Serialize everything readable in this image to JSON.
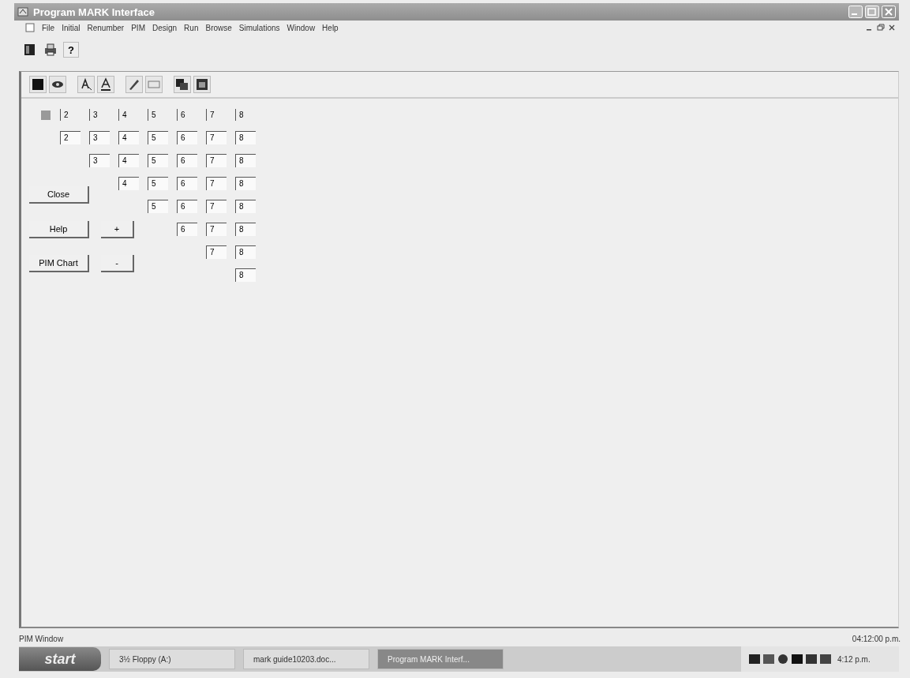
{
  "window": {
    "title": "Program MARK Interface"
  },
  "menu": [
    "File",
    "Initial",
    "Renumber",
    "PIM",
    "Design",
    "Run",
    "Browse",
    "Simulations",
    "Window",
    "Help"
  ],
  "toolbar": {
    "help_button": "?"
  },
  "matrix": {
    "header": [
      "2",
      "3",
      "4",
      "5",
      "6",
      "7",
      "8"
    ],
    "rows": [
      {
        "cells": [
          "2",
          "3",
          "4",
          "5",
          "6",
          "7",
          "8"
        ]
      },
      {
        "cells": [
          "",
          "3",
          "4",
          "5",
          "6",
          "7",
          "8"
        ]
      },
      {
        "cells": [
          "",
          "",
          "4",
          "5",
          "6",
          "7",
          "8"
        ]
      },
      {
        "cells": [
          "",
          "",
          "",
          "5",
          "6",
          "7",
          "8"
        ]
      },
      {
        "cells": [
          "",
          "",
          "",
          "",
          "6",
          "7",
          "8"
        ]
      },
      {
        "cells": [
          "",
          "",
          "",
          "",
          "",
          "7",
          "8"
        ]
      },
      {
        "cells": [
          "",
          "",
          "",
          "",
          "",
          "",
          "8"
        ]
      }
    ]
  },
  "buttons": [
    {
      "kind": "close",
      "label": "Close"
    },
    {
      "kind": "help",
      "label": "Help"
    },
    {
      "kind": "chart",
      "label": "PIM Chart"
    },
    {
      "kind": "plus",
      "label": "+"
    },
    {
      "kind": "minus",
      "label": "-"
    }
  ],
  "status_bar": {
    "text": "PIM Window",
    "time": "04:12:00 p.m."
  },
  "taskbar": {
    "start": "start",
    "tasks": [
      {
        "label": "3½ Floppy (A:)",
        "selected": false
      },
      {
        "label": "mark guide10203.doc...",
        "selected": false
      },
      {
        "label": "Program MARK Interf...",
        "selected": true
      }
    ],
    "clock": "4:12 p.m."
  }
}
